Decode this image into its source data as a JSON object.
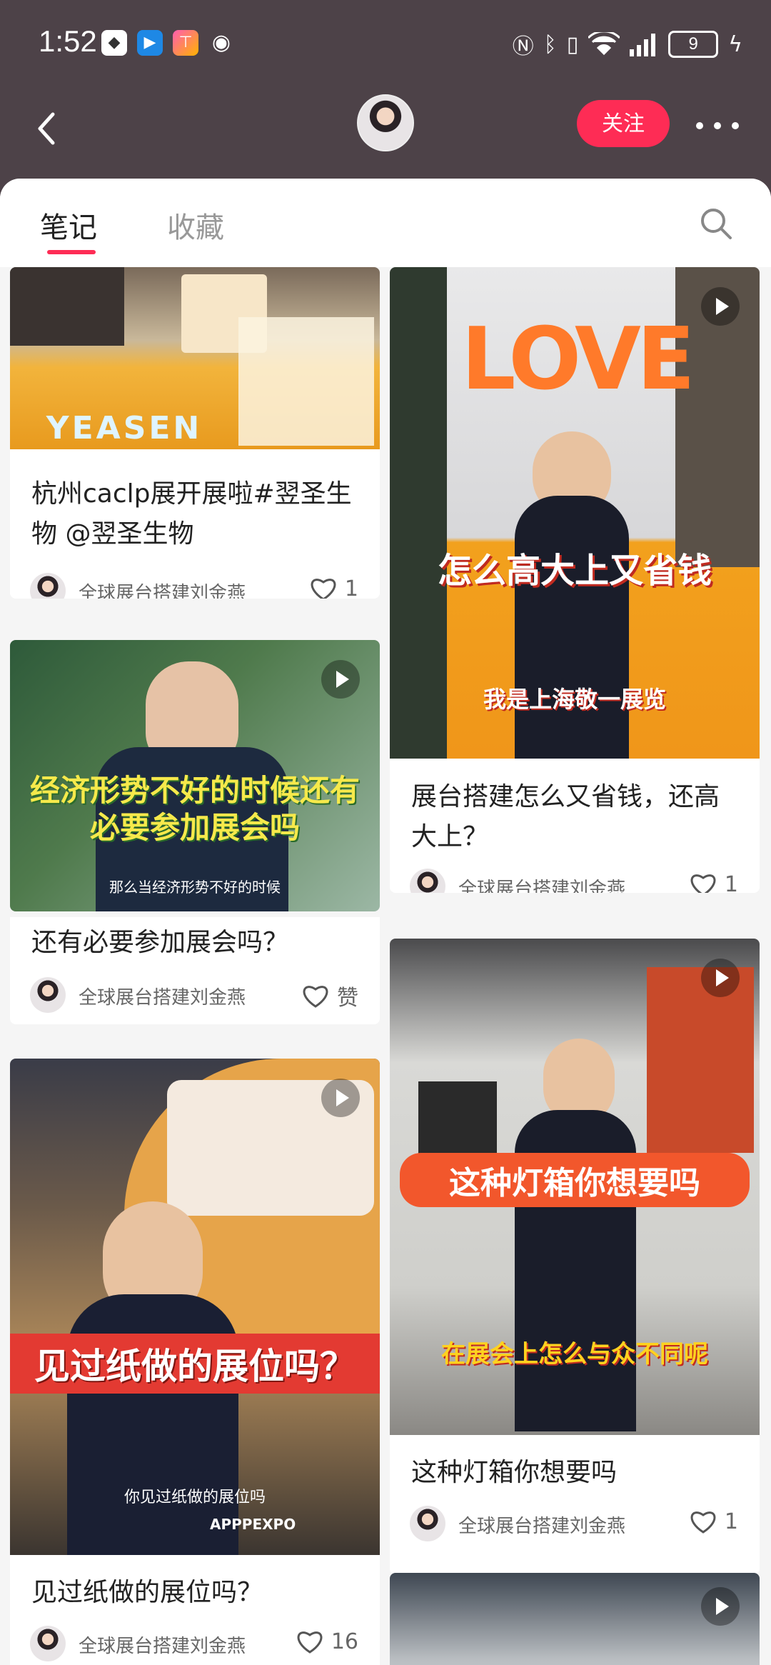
{
  "status_bar": {
    "time": "1:52",
    "battery": "9"
  },
  "header": {
    "follow_label": "关注"
  },
  "tabs": {
    "notes": "笔记",
    "favorites": "收藏"
  },
  "colors": {
    "accent": "#fe2c55",
    "header_bg": "#4d4248"
  },
  "feed": {
    "author": "全球展台搭建刘金燕",
    "cards": [
      {
        "title": "杭州caclp展开展啦#翌圣生物 @翌圣生物",
        "likes": "1",
        "thumb_text": "YEASEN"
      },
      {
        "title": "还有必要参加展会吗？",
        "likes": "赞",
        "overlay": "经济形势不好的时候还有必要参加展会吗",
        "subtitle": "那么当经济形势不好的时候"
      },
      {
        "title": "见过纸做的展位吗？",
        "likes": "16",
        "overlay": "见过纸做的展位吗？",
        "subtitle": "你见过纸做的展位吗",
        "brand": "APPPEXPO"
      },
      {
        "title": "展台搭建怎么又省钱，还高大上？",
        "likes": "1",
        "overlay": "怎么高大上又省钱",
        "overlay2": "我是上海敬一展览",
        "sign": "LOVE"
      },
      {
        "title": "这种灯箱你想要吗",
        "likes": "1",
        "overlay": "这种灯箱你想要吗",
        "overlay2": "在展会上怎么与众不同呢"
      }
    ]
  }
}
